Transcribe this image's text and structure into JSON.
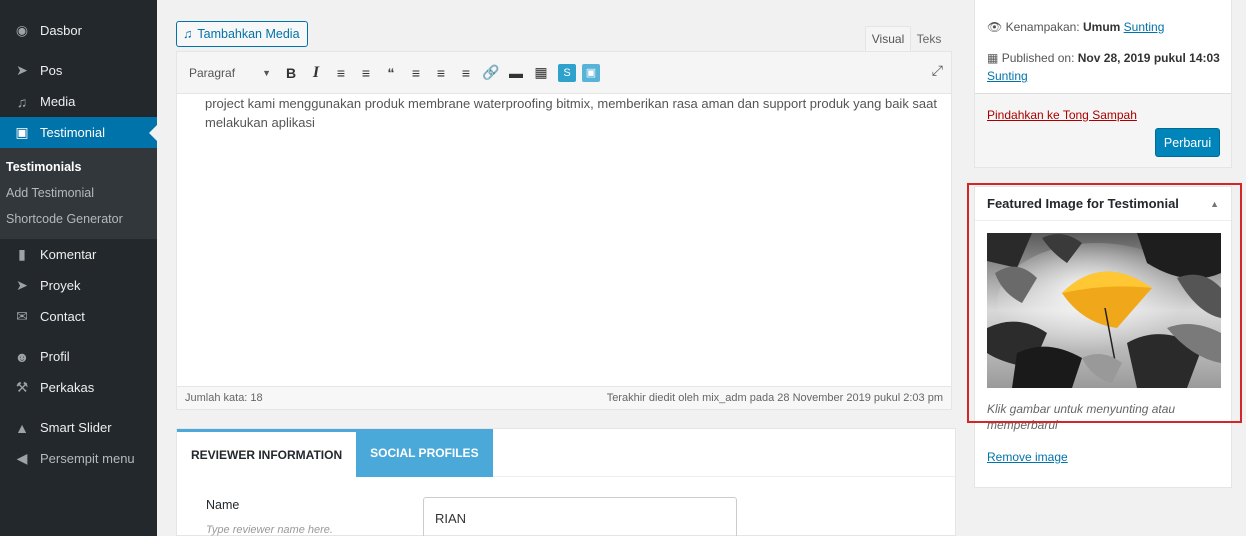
{
  "sidebar": {
    "items": [
      {
        "label": "Dasbor",
        "icon": "dashboard-icon"
      },
      {
        "label": "Pos",
        "icon": "pin-icon"
      },
      {
        "label": "Media",
        "icon": "media-icon"
      },
      {
        "label": "Testimonial",
        "icon": "testimonial-icon",
        "active": true
      },
      {
        "label": "Komentar",
        "icon": "comment-icon"
      },
      {
        "label": "Proyek",
        "icon": "pin-icon"
      },
      {
        "label": "Contact",
        "icon": "mail-icon"
      },
      {
        "label": "Profil",
        "icon": "user-icon"
      },
      {
        "label": "Perkakas",
        "icon": "wrench-icon"
      },
      {
        "label": "Smart Slider",
        "icon": "slider-icon"
      },
      {
        "label": "Persempit menu",
        "icon": "collapse-icon"
      }
    ],
    "submenu": [
      "Testimonials",
      "Add Testimonial",
      "Shortcode Generator"
    ]
  },
  "editor": {
    "add_media_label": "Tambahkan Media",
    "tab_visual": "Visual",
    "tab_text": "Teks",
    "format_select": "Paragraf",
    "content": "project kami menggunakan produk membrane waterproofing bitmix, memberikan rasa aman dan support produk yang baik saat melakukan aplikasi",
    "word_count": "Jumlah kata: 18",
    "last_edited": "Terakhir diedit oleh mix_adm pada 28 November 2019 pukul 2:03 pm"
  },
  "reviewer": {
    "tab_reviewer": "REVIEWER INFORMATION",
    "tab_social": "SOCIAL PROFILES",
    "name_label": "Name",
    "name_hint": "Type reviewer name here.",
    "name_value": "RIAN"
  },
  "publish": {
    "visibility_label": "Kenampakan:",
    "visibility_value": "Umum",
    "edit_link": "Sunting",
    "published_label": "Published on:",
    "published_value": "Nov 28, 2019 pukul 14:03",
    "trash_link": "Pindahkan ke Tong Sampah",
    "update_button": "Perbarui"
  },
  "featured_image": {
    "title": "Featured Image for Testimonial",
    "caption": "Klik gambar untuk menyunting atau memperbarui",
    "remove_link": "Remove image"
  },
  "colors": {
    "sidebar_bg": "#23282d",
    "active_menu": "#0073aa",
    "highlight_border": "#d42626",
    "tab_blue": "#4aa9d9"
  }
}
